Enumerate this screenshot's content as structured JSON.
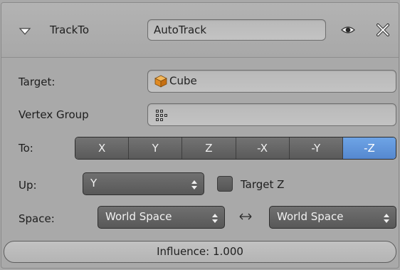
{
  "header": {
    "constraint_type": "TrackTo",
    "name_value": "AutoTrack",
    "icons": {
      "collapse": "triangle-down-icon",
      "visibility": "eye-icon",
      "remove": "close-x-icon"
    }
  },
  "target": {
    "label": "Target:",
    "value": "Cube",
    "icon": "cube-object-icon"
  },
  "vertex_group": {
    "label": "Vertex Group",
    "value": "",
    "icon": "vertex-group-grid-icon"
  },
  "to": {
    "label": "To:",
    "options": [
      "X",
      "Y",
      "Z",
      "-X",
      "-Y",
      "-Z"
    ],
    "selected": "-Z"
  },
  "up": {
    "label": "Up:",
    "value": "Y",
    "target_z_label": "Target Z",
    "target_z_checked": false
  },
  "space": {
    "label": "Space:",
    "owner_space": "World Space",
    "target_space": "World Space",
    "swap_icon": "double-arrow-icon"
  },
  "influence": {
    "text": "Influence: 1.000",
    "value": 1.0
  },
  "colors": {
    "panel_bg": "#a9a9a9",
    "button_dark": "#5a5a5a",
    "button_active": "#5d8fd6",
    "cube_orange": "#e8902a"
  }
}
